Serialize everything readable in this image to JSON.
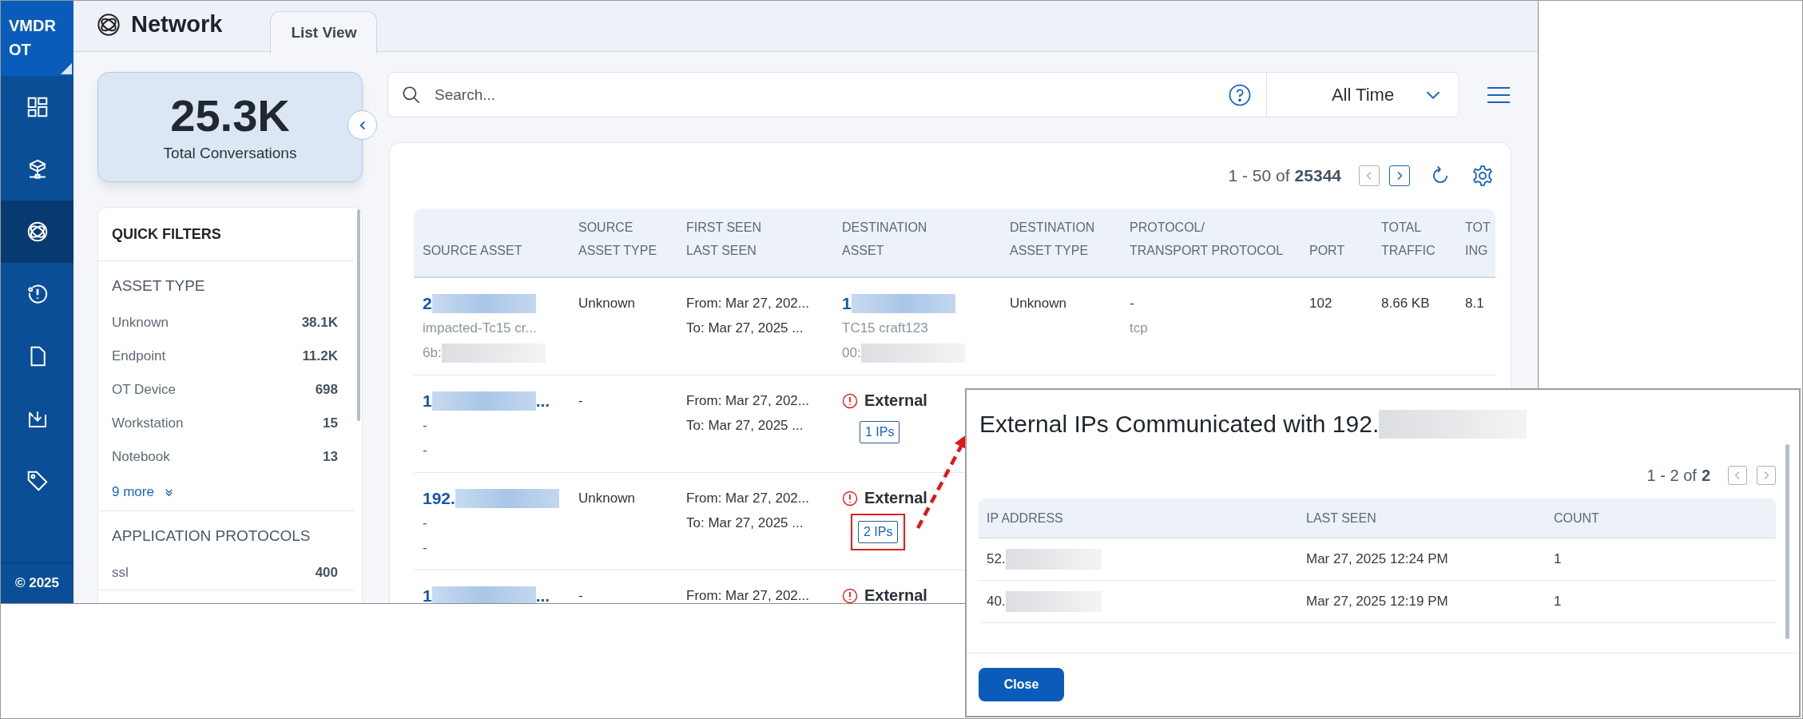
{
  "sidebar": {
    "brand": [
      "VMDR",
      "OT"
    ],
    "items": [
      {
        "kind": "dashboard",
        "selected": false
      },
      {
        "kind": "asset-network",
        "selected": false
      },
      {
        "kind": "network",
        "selected": true
      },
      {
        "kind": "alert-history",
        "selected": false
      },
      {
        "kind": "document",
        "selected": false
      },
      {
        "kind": "download",
        "selected": false
      },
      {
        "kind": "tag",
        "selected": false
      }
    ],
    "footer": "© 2025"
  },
  "header": {
    "title": "Network",
    "tabs": [
      {
        "label": "List View",
        "selected": true
      }
    ]
  },
  "summary": {
    "value": "25.3K",
    "label": "Total Conversations"
  },
  "quick_filters": {
    "title": "QUICK FILTERS",
    "sections": [
      {
        "title": "ASSET TYPE",
        "items": [
          {
            "label": "Unknown",
            "count": "38.1K"
          },
          {
            "label": "Endpoint",
            "count": "11.2K"
          },
          {
            "label": "OT Device",
            "count": "698"
          },
          {
            "label": "Workstation",
            "count": "15"
          },
          {
            "label": "Notebook",
            "count": "13"
          }
        ],
        "more": "9 more"
      },
      {
        "title": "APPLICATION PROTOCOLS",
        "items": [
          {
            "label": "ssl",
            "count": "400"
          }
        ]
      }
    ]
  },
  "search": {
    "placeholder": "Search...",
    "time_range": "All Time"
  },
  "table": {
    "pager": {
      "range": "1 - 50 of",
      "total": "25344",
      "prev_disabled": true,
      "next_disabled": false
    },
    "columns": [
      [
        "",
        "SOURCE ASSET"
      ],
      [
        "SOURCE",
        "ASSET TYPE"
      ],
      [
        "FIRST SEEN",
        "LAST SEEN"
      ],
      [
        "DESTINATION",
        "ASSET"
      ],
      [
        "DESTINATION",
        "ASSET TYPE"
      ],
      [
        "PROTOCOL/",
        "TRANSPORT PROTOCOL"
      ],
      [
        "",
        "PORT"
      ],
      [
        "TOTAL",
        "TRAFFIC"
      ],
      [
        "TOT",
        "ING"
      ]
    ],
    "rows": [
      {
        "source": [
          {
            "text": "2",
            "redacted": true,
            "kind": "address"
          },
          {
            "text": "impacted-Tc15 cr...",
            "kind": "detail"
          },
          {
            "text": "6b:",
            "redacted": true,
            "kind": "detail"
          }
        ],
        "source_type": "Unknown",
        "seen": [
          "From: Mar 27, 202...",
          "To: Mar 27, 2025 ..."
        ],
        "destination": {
          "kind": "asset",
          "lines": [
            {
              "text": "1",
              "redacted": true,
              "kind": "address"
            },
            {
              "text": "TC15 craft123",
              "kind": "detail"
            },
            {
              "text": "00:",
              "redacted": true,
              "kind": "detail"
            }
          ]
        },
        "destination_type": "Unknown",
        "protocol": [
          "-",
          "tcp"
        ],
        "port": "102",
        "total_traffic": "8.66 KB",
        "column_9": "8.1"
      },
      {
        "source": [
          {
            "text": "1",
            "redacted": true,
            "suffix": "...",
            "kind": "address"
          },
          {
            "text": "-",
            "kind": "link"
          },
          {
            "text": "-",
            "kind": "link"
          }
        ],
        "source_type": "-",
        "seen": [
          "From: Mar 27, 202...",
          "To: Mar 27, 2025 ..."
        ],
        "destination": {
          "kind": "external",
          "label": "External",
          "badge": {
            "text": "1 IPs",
            "highlighted": false
          }
        }
      },
      {
        "source": [
          {
            "text": "192.",
            "redacted": true,
            "kind": "address"
          },
          {
            "text": "-",
            "kind": "link"
          },
          {
            "text": "-",
            "kind": "link"
          }
        ],
        "source_type": "Unknown",
        "seen": [
          "From: Mar 27, 202...",
          "To: Mar 27, 2025 ..."
        ],
        "destination": {
          "kind": "external",
          "label": "External",
          "badge": {
            "text": "2 IPs",
            "highlighted": true
          }
        }
      },
      {
        "source": [
          {
            "text": "1",
            "redacted": true,
            "suffix": "...",
            "kind": "address"
          }
        ],
        "source_type": "-",
        "seen": [
          "From: Mar 27, 202..."
        ],
        "destination": {
          "kind": "external",
          "label": "External"
        }
      }
    ]
  },
  "modal": {
    "title": "External IPs Communicated with 192.",
    "title_redacted": true,
    "pager": {
      "range": "1 - 2 of",
      "total": "2",
      "prev_disabled": true,
      "next_disabled": true
    },
    "columns": [
      "IP ADDRESS",
      "LAST SEEN",
      "COUNT"
    ],
    "rows": [
      {
        "ip": "52.",
        "ip_redacted": true,
        "last_seen": "Mar 27, 2025 12:24 PM",
        "count": "1"
      },
      {
        "ip": "40.",
        "ip_redacted": true,
        "last_seen": "Mar 27, 2025 12:19 PM",
        "count": "1"
      }
    ],
    "close": "Close"
  }
}
